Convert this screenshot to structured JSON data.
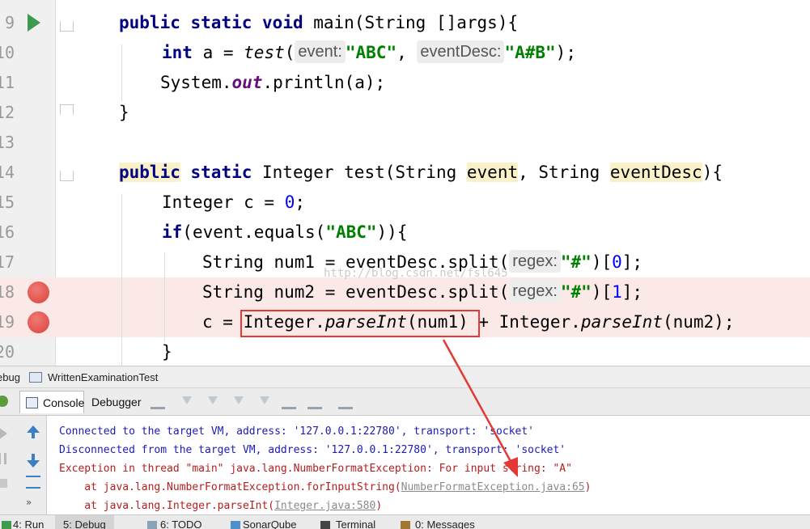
{
  "editor": {
    "lines": [
      {
        "n": "9",
        "tokens": [
          [
            "kw",
            "public"
          ],
          [
            "p",
            " "
          ],
          [
            "kw",
            "static"
          ],
          [
            "p",
            " "
          ],
          [
            "kw",
            "void"
          ],
          [
            "p",
            " main(String []args){"
          ]
        ]
      },
      {
        "n": "10",
        "tokens": [
          [
            "kw",
            "int"
          ],
          [
            "p",
            " a = "
          ],
          [
            "it",
            "test"
          ],
          [
            "p",
            "("
          ],
          [
            "hint",
            "event:"
          ],
          [
            "str",
            "\"ABC\""
          ],
          [
            "p",
            ", "
          ],
          [
            "hint",
            "eventDesc:"
          ],
          [
            "str",
            "\"A#B\""
          ],
          [
            "p",
            ");"
          ]
        ]
      },
      {
        "n": "11",
        "tokens": [
          [
            "p",
            "System."
          ],
          [
            "fld",
            "out"
          ],
          [
            "p",
            ".println(a);"
          ]
        ]
      },
      {
        "n": "12",
        "tokens": [
          [
            "p",
            "}"
          ]
        ]
      },
      {
        "n": "13",
        "tokens": []
      },
      {
        "n": "14",
        "tokens": [
          [
            "kwh",
            "public"
          ],
          [
            "p",
            " "
          ],
          [
            "kw",
            "static"
          ],
          [
            "p",
            " Integer test(String "
          ],
          [
            "yh",
            "event"
          ],
          [
            "p",
            ", String "
          ],
          [
            "yh",
            "eventDesc"
          ],
          [
            "p",
            "){"
          ]
        ]
      },
      {
        "n": "15",
        "tokens": [
          [
            "p",
            "Integer c = "
          ],
          [
            "num",
            "0"
          ],
          [
            "p",
            ";"
          ]
        ]
      },
      {
        "n": "16",
        "tokens": [
          [
            "kw",
            "if"
          ],
          [
            "p",
            "(event.equals("
          ],
          [
            "str",
            "\"ABC\""
          ],
          [
            "p",
            "))"
          ],
          [
            "p",
            "{"
          ]
        ]
      },
      {
        "n": "17",
        "tokens": [
          [
            "p",
            "String num1 = eventDesc.split("
          ],
          [
            "hint",
            "regex:"
          ],
          [
            "str",
            "\"#\""
          ],
          [
            "p",
            ")["
          ],
          [
            "num",
            "0"
          ],
          [
            "p",
            "];"
          ]
        ]
      },
      {
        "n": "18",
        "tokens": [
          [
            "p",
            "String num2 = eventDesc.split("
          ],
          [
            "hint",
            "regex:"
          ],
          [
            "str",
            "\"#\""
          ],
          [
            "p",
            ")["
          ],
          [
            "num",
            "1"
          ],
          [
            "p",
            "];"
          ]
        ]
      },
      {
        "n": "19",
        "tokens": [
          [
            "p",
            "c = Integer."
          ],
          [
            "it",
            "parseInt"
          ],
          [
            "p",
            "(num1) + Integer."
          ],
          [
            "it",
            "parseInt"
          ],
          [
            "p",
            "(num2);"
          ]
        ]
      },
      {
        "n": "20",
        "tokens": [
          [
            "p",
            "}"
          ]
        ]
      }
    ],
    "watermark": "http://blog.csdn.net/fsl645"
  },
  "debug_window": {
    "title_prefix": "ebug",
    "config_name": "WrittenExaminationTest",
    "tabs": {
      "console": "Console",
      "debugger": "Debugger"
    },
    "more": "»"
  },
  "console": {
    "lines": [
      {
        "kind": "blue",
        "text": "Connected to the target VM, address: '127.0.0.1:22780', transport: 'socket'"
      },
      {
        "kind": "blue",
        "text": "Disconnected from the target VM, address: '127.0.0.1:22780', transport: 'socket'"
      },
      {
        "kind": "red",
        "text": "Exception in thread \"main\" java.lang.NumberFormatException: For input string: \"A\""
      },
      {
        "kind": "red",
        "text": "    at java.lang.NumberFormatException.forInputString(",
        "link": "NumberFormatException.java:65",
        "tail": ")"
      },
      {
        "kind": "red",
        "text": "    at java.lang.Integer.parseInt(",
        "link": "Integer.java:580",
        "tail": ")"
      }
    ]
  },
  "bottom_bar": {
    "items": [
      "4: Run",
      "5: Debug",
      "6: TODO",
      "SonarQube",
      "Terminal",
      "0: Messages"
    ]
  },
  "colors": {
    "breakpoint": "#d9423b",
    "highlight_box": "#e53935",
    "keyword": "#000080",
    "string": "#008000"
  }
}
